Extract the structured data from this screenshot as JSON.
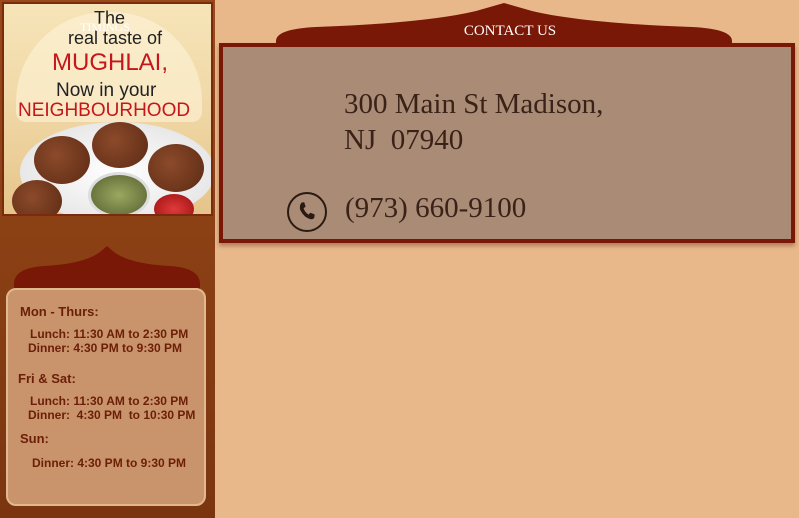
{
  "promo": {
    "line1": "The",
    "line2": "real taste of",
    "line3": "MUGHLAI,",
    "line4": "Now in your",
    "line5": "NEIGHBOURHOOD"
  },
  "timings": {
    "title": "TIMINGS",
    "groups": [
      {
        "day": "Mon - Thurs:",
        "lines": [
          "Lunch: 11:30 AM to 2:30 PM",
          "Dinner: 4:30 PM to 9:30 PM"
        ]
      },
      {
        "day": "Fri & Sat:",
        "lines": [
          "Lunch: 11:30 AM to 2:30 PM",
          "Dinner:  4:30 PM  to 10:30 PM"
        ]
      },
      {
        "day": "Sun:",
        "lines": [
          "Dinner: 4:30 PM to 9:30 PM"
        ]
      }
    ]
  },
  "contact": {
    "title": "CONTACT US",
    "address_line1": "300 Main St Madison,",
    "address_line2": "NJ  07940",
    "phone": "(973) 660-9100",
    "phone_icon": "phone-icon"
  },
  "colors": {
    "page_bg": "#e8b88a",
    "maroon": "#7a1808",
    "contact_bg": "#a98b76",
    "timings_bg": "#c9946b",
    "promo_red": "#c4161c"
  }
}
